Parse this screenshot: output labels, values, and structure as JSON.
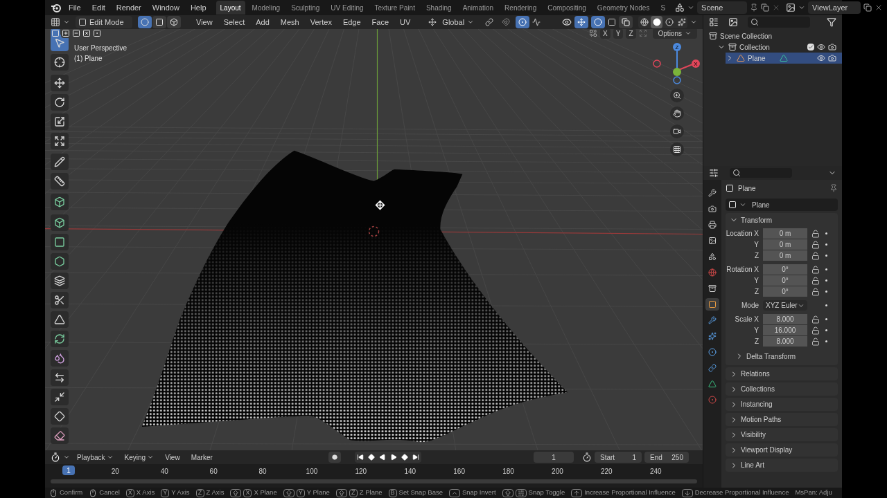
{
  "menu": [
    "File",
    "Edit",
    "Render",
    "Window",
    "Help"
  ],
  "workspaces": [
    {
      "label": "Layout",
      "selected": true
    },
    {
      "label": "Modeling",
      "selected": false
    },
    {
      "label": "Sculpting",
      "selected": false
    },
    {
      "label": "UV Editing",
      "selected": false
    },
    {
      "label": "Texture Paint",
      "selected": false
    },
    {
      "label": "Shading",
      "selected": false
    },
    {
      "label": "Animation",
      "selected": false
    },
    {
      "label": "Rendering",
      "selected": false
    },
    {
      "label": "Compositing",
      "selected": false
    },
    {
      "label": "Geometry Nodes",
      "selected": false
    },
    {
      "label": "S",
      "selected": false
    }
  ],
  "scene": "Scene",
  "view_layer": "ViewLayer",
  "viewport": {
    "mode": "Edit Mode",
    "select_modes": [
      {
        "kind": "vertex",
        "selected": true
      },
      {
        "kind": "edge",
        "selected": false
      },
      {
        "kind": "face",
        "selected": false
      }
    ],
    "menus": [
      "View",
      "Select",
      "Add",
      "Mesh",
      "Vertex",
      "Edge",
      "Face",
      "UV"
    ],
    "orientation": "Global",
    "proportional": {
      "on": true
    },
    "gizmos": {
      "on": true
    },
    "overlays": {
      "on": true
    },
    "xray": {
      "on": false
    },
    "shading": [
      {
        "kind": "wireframe",
        "selected": false
      },
      {
        "kind": "solid",
        "selected": true
      },
      {
        "kind": "material",
        "selected": false
      },
      {
        "kind": "rendered",
        "selected": false
      }
    ],
    "box_modes": [
      {
        "kind": "new",
        "selected": true
      },
      {
        "kind": "extend",
        "selected": false
      },
      {
        "kind": "subtract",
        "selected": false
      },
      {
        "kind": "invert",
        "selected": false
      },
      {
        "kind": "intersect",
        "selected": false
      }
    ],
    "mirror_axes": [
      {
        "label": "X",
        "on": false
      },
      {
        "label": "Y",
        "on": false
      },
      {
        "label": "Z",
        "on": false
      }
    ],
    "options": "Options",
    "overlay_text": [
      "User Perspective",
      "(1) Plane"
    ],
    "gizmo_axes": [
      {
        "label": "Z"
      },
      {
        "label": "X"
      }
    ],
    "tool_groups": [
      [
        {
          "kind": "select",
          "selected": true
        },
        {
          "kind": "cursor",
          "selected": false
        }
      ],
      [
        {
          "kind": "move",
          "selected": false
        },
        {
          "kind": "rotate",
          "selected": false
        },
        {
          "kind": "scale",
          "selected": false
        },
        {
          "kind": "transform",
          "selected": false
        }
      ],
      [
        {
          "kind": "annotate",
          "selected": false
        },
        {
          "kind": "measure",
          "selected": false
        }
      ],
      [
        {
          "kind": "add_cube",
          "selected": false
        }
      ],
      [
        {
          "kind": "extrude",
          "selected": false
        },
        {
          "kind": "inset",
          "selected": false
        },
        {
          "kind": "bevel",
          "selected": false
        },
        {
          "kind": "loop_cut",
          "selected": false
        },
        {
          "kind": "knife",
          "selected": false
        },
        {
          "kind": "poly_build",
          "selected": false
        },
        {
          "kind": "spin",
          "selected": false
        },
        {
          "kind": "smooth",
          "selected": false
        },
        {
          "kind": "edge_slide",
          "selected": false
        },
        {
          "kind": "shrink",
          "selected": false
        },
        {
          "kind": "shear",
          "selected": false
        },
        {
          "kind": "rip",
          "selected": false
        }
      ]
    ]
  },
  "outliner": {
    "tree": [
      {
        "kind": "scene_collection",
        "label": "Scene Collection",
        "children": [
          {
            "kind": "collection",
            "label": "Collection",
            "expanded": true,
            "checked": true,
            "children": [
              {
                "kind": "mesh_object",
                "label": "Plane",
                "expanded": false,
                "selected": true
              }
            ]
          }
        ]
      }
    ]
  },
  "properties": {
    "tabs": [
      {
        "kind": "tool",
        "selected": false
      },
      {
        "kind": "render",
        "selected": false
      },
      {
        "kind": "output",
        "selected": false
      },
      {
        "kind": "view_layer",
        "selected": false
      },
      {
        "kind": "scene",
        "selected": false
      },
      {
        "kind": "world",
        "selected": false
      },
      {
        "kind": "collection",
        "selected": false
      },
      {
        "kind": "object",
        "selected": true
      },
      {
        "kind": "modifiers",
        "selected": false
      },
      {
        "kind": "particles",
        "selected": false
      },
      {
        "kind": "physics",
        "selected": false
      },
      {
        "kind": "constraints",
        "selected": false
      },
      {
        "kind": "data",
        "selected": false
      },
      {
        "kind": "material",
        "selected": false
      }
    ],
    "object_name": "Plane",
    "datablock": "Plane",
    "transform": {
      "label": "Transform",
      "expanded": true,
      "groups": [
        [
          {
            "kind": "number",
            "label": "Location X",
            "value": "0 m"
          },
          {
            "kind": "number",
            "label": "Y",
            "value": "0 m"
          },
          {
            "kind": "number",
            "label": "Z",
            "value": "0 m"
          }
        ],
        [
          {
            "kind": "number",
            "label": "Rotation X",
            "value": "0°"
          },
          {
            "kind": "number",
            "label": "Y",
            "value": "0°"
          },
          {
            "kind": "number",
            "label": "Z",
            "value": "0°"
          }
        ],
        [
          {
            "kind": "dropdown",
            "label": "Mode",
            "value": "XYZ Euler"
          }
        ],
        [
          {
            "kind": "number",
            "label": "Scale X",
            "value": "8.000"
          },
          {
            "kind": "number",
            "label": "Y",
            "value": "16.000"
          },
          {
            "kind": "number",
            "label": "Z",
            "value": "8.000"
          }
        ]
      ],
      "subpanel": {
        "label": "Delta Transform",
        "expanded": false
      }
    },
    "panels": [
      {
        "label": "Relations",
        "expanded": false
      },
      {
        "label": "Collections",
        "expanded": false
      },
      {
        "label": "Instancing",
        "expanded": false
      },
      {
        "label": "Motion Paths",
        "expanded": false
      },
      {
        "label": "Visibility",
        "expanded": false
      },
      {
        "label": "Viewport Display",
        "expanded": false
      },
      {
        "label": "Line Art",
        "expanded": false
      }
    ]
  },
  "timeline": {
    "menus": [
      {
        "label": "Playback",
        "dropdown": true
      },
      {
        "label": "Keying",
        "dropdown": true
      },
      {
        "label": "View",
        "dropdown": false
      },
      {
        "label": "Marker",
        "dropdown": false
      }
    ],
    "current_frame": "1",
    "start_label": "Start",
    "start": "1",
    "end_label": "End",
    "end": "250",
    "playhead": "1",
    "ticks": [
      "20",
      "40",
      "60",
      "80",
      "100",
      "120",
      "140",
      "160",
      "180",
      "200",
      "220",
      "240"
    ]
  },
  "status_bar": [
    {
      "keys": [
        {
          "kind": "mouse_left"
        }
      ],
      "label": "Confirm"
    },
    {
      "keys": [
        {
          "kind": "mouse_right"
        }
      ],
      "label": "Cancel"
    },
    {
      "keys": [
        {
          "kind": "letter",
          "text": "X"
        }
      ],
      "label": "X Axis"
    },
    {
      "keys": [
        {
          "kind": "letter",
          "text": "Y"
        }
      ],
      "label": "Y Axis"
    },
    {
      "keys": [
        {
          "kind": "letter",
          "text": "Z"
        }
      ],
      "label": "Z Axis"
    },
    {
      "keys": [
        {
          "kind": "shift"
        },
        {
          "kind": "letter",
          "text": "X"
        }
      ],
      "label": "X Plane"
    },
    {
      "keys": [
        {
          "kind": "shift"
        },
        {
          "kind": "letter",
          "text": "Y"
        }
      ],
      "label": "Y Plane"
    },
    {
      "keys": [
        {
          "kind": "shift"
        },
        {
          "kind": "letter",
          "text": "Z"
        }
      ],
      "label": "Z Plane"
    },
    {
      "keys": [
        {
          "kind": "letter",
          "text": "B"
        }
      ],
      "label": "Set Snap Base"
    },
    {
      "keys": [
        {
          "kind": "ctrl"
        }
      ],
      "label": "Snap Invert"
    },
    {
      "keys": [
        {
          "kind": "shift"
        },
        {
          "kind": "tab"
        }
      ],
      "label": "Snap Toggle"
    },
    {
      "keys": [
        {
          "kind": "page_up"
        }
      ],
      "label": "Increase Proportional Influence"
    },
    {
      "keys": [
        {
          "kind": "page_down"
        }
      ],
      "label": "Decrease Proportional Influence"
    },
    {
      "label": "MsPan: Adju"
    }
  ]
}
